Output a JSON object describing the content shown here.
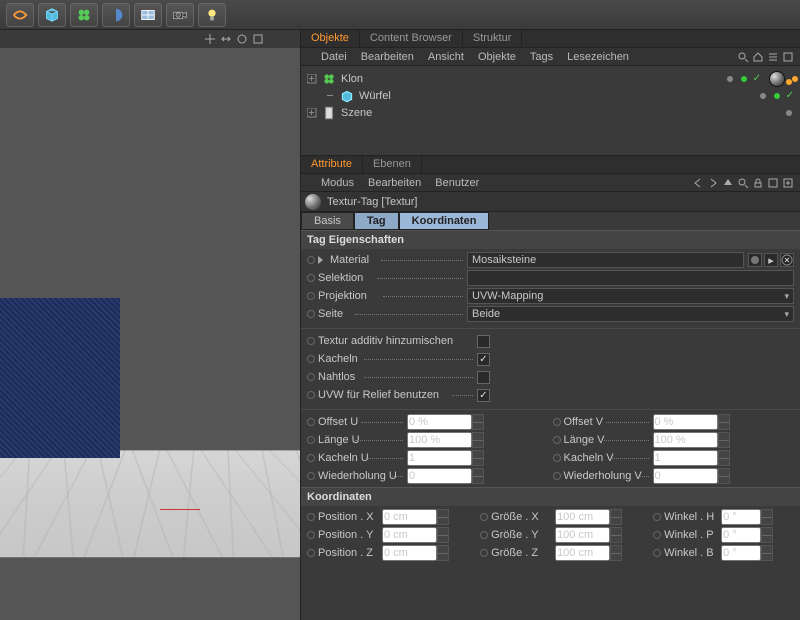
{
  "toolbar_icons": [
    "deformer",
    "cube",
    "clone",
    "boole",
    "floor",
    "camera",
    "light"
  ],
  "objects_tabs": [
    "Objekte",
    "Content Browser",
    "Struktur"
  ],
  "objects_menu": [
    "Datei",
    "Bearbeiten",
    "Ansicht",
    "Objekte",
    "Tags",
    "Lesezeichen"
  ],
  "tree": [
    {
      "name": "Klon",
      "indent": 0,
      "expandable": true,
      "tag": true
    },
    {
      "name": "Würfel",
      "indent": 1,
      "expandable": false,
      "tag": false
    },
    {
      "name": "Szene",
      "indent": 0,
      "expandable": true,
      "tag": false,
      "icon": "scene"
    }
  ],
  "attr_tabs": [
    "Attribute",
    "Ebenen"
  ],
  "attr_menu": [
    "Modus",
    "Bearbeiten",
    "Benutzer"
  ],
  "attr_title": "Textur-Tag [Textur]",
  "subtabs": [
    "Basis",
    "Tag",
    "Koordinaten"
  ],
  "sections": {
    "tag": {
      "title": "Tag Eigenschaften",
      "material_label": "Material",
      "material_value": "Mosaiksteine",
      "selektion_label": "Selektion",
      "selektion_value": "",
      "projektion_label": "Projektion",
      "projektion_value": "UVW-Mapping",
      "seite_label": "Seite",
      "seite_value": "Beide",
      "checks": [
        {
          "label": "Textur additiv hinzumischen",
          "on": false
        },
        {
          "label": "Kacheln",
          "on": true
        },
        {
          "label": "Nahtlos",
          "on": false
        },
        {
          "label": "UVW für Relief benutzen",
          "on": true
        }
      ],
      "uv": [
        {
          "l1": "Offset U",
          "v1": "0 %",
          "l2": "Offset V",
          "v2": "0 %"
        },
        {
          "l1": "Länge U",
          "v1": "100 %",
          "l2": "Länge V",
          "v2": "100 %"
        },
        {
          "l1": "Kacheln U",
          "v1": "1",
          "l2": "Kacheln V",
          "v2": "1"
        },
        {
          "l1": "Wiederholung U",
          "v1": "0",
          "l2": "Wiederholung V",
          "v2": "0"
        }
      ]
    },
    "coord": {
      "title": "Koordinaten",
      "rows": [
        {
          "l1": "Position . X",
          "v1": "0 cm",
          "l2": "Größe . X",
          "v2": "100 cm",
          "l3": "Winkel . H",
          "v3": "0 °"
        },
        {
          "l1": "Position . Y",
          "v1": "0 cm",
          "l2": "Größe . Y",
          "v2": "100 cm",
          "l3": "Winkel . P",
          "v3": "0 °"
        },
        {
          "l1": "Position . Z",
          "v1": "0 cm",
          "l2": "Größe . Z",
          "v2": "100 cm",
          "l3": "Winkel . B",
          "v3": "0 °"
        }
      ]
    }
  }
}
